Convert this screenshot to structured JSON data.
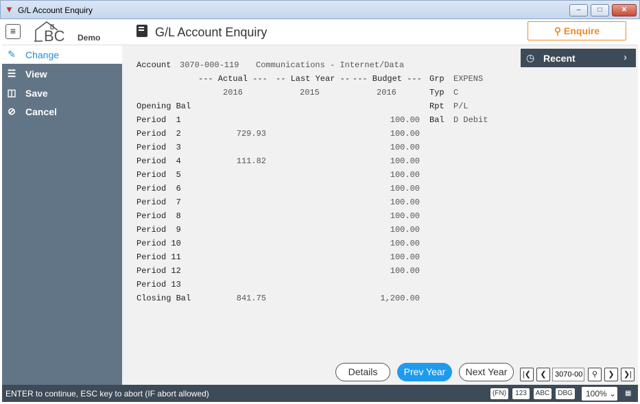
{
  "window": {
    "title": "G/L Account Enquiry"
  },
  "header": {
    "logo_text": "BC",
    "logo_sub": "Demo",
    "page_title": "G/L Account Enquiry",
    "enquire_label": "Enquire"
  },
  "sidebar": {
    "items": [
      {
        "label": "Change",
        "icon": "pencil-icon"
      },
      {
        "label": "View",
        "icon": "list-icon"
      },
      {
        "label": "Save",
        "icon": "save-icon"
      },
      {
        "label": "Cancel",
        "icon": "cancel-icon"
      }
    ]
  },
  "recent": {
    "label": "Recent"
  },
  "account": {
    "label": "Account",
    "code": "3070-000-119",
    "description": "Communications - Internet/Data"
  },
  "table": {
    "headers": [
      "--- Actual ---",
      "-- Last Year --",
      "--- Budget ---"
    ],
    "years": [
      "2016",
      "2015",
      "2016"
    ],
    "rows": [
      {
        "label": "Opening Bal",
        "actual": "",
        "last": "",
        "budget": ""
      },
      {
        "label": "Period  1",
        "actual": "",
        "last": "",
        "budget": "100.00"
      },
      {
        "label": "Period  2",
        "actual": "729.93",
        "last": "",
        "budget": "100.00"
      },
      {
        "label": "Period  3",
        "actual": "",
        "last": "",
        "budget": "100.00"
      },
      {
        "label": "Period  4",
        "actual": "111.82",
        "last": "",
        "budget": "100.00"
      },
      {
        "label": "Period  5",
        "actual": "",
        "last": "",
        "budget": "100.00"
      },
      {
        "label": "Period  6",
        "actual": "",
        "last": "",
        "budget": "100.00"
      },
      {
        "label": "Period  7",
        "actual": "",
        "last": "",
        "budget": "100.00"
      },
      {
        "label": "Period  8",
        "actual": "",
        "last": "",
        "budget": "100.00"
      },
      {
        "label": "Period  9",
        "actual": "",
        "last": "",
        "budget": "100.00"
      },
      {
        "label": "Period 10",
        "actual": "",
        "last": "",
        "budget": "100.00"
      },
      {
        "label": "Period 11",
        "actual": "",
        "last": "",
        "budget": "100.00"
      },
      {
        "label": "Period 12",
        "actual": "",
        "last": "",
        "budget": "100.00"
      },
      {
        "label": "Period 13",
        "actual": "",
        "last": "",
        "budget": ""
      },
      {
        "label": "Closing Bal",
        "actual": "841.75",
        "last": "",
        "budget": "1,200.00"
      }
    ]
  },
  "info": [
    {
      "key": "Grp",
      "value": "EXPENS"
    },
    {
      "key": "Typ",
      "value": "C"
    },
    {
      "key": "Rpt",
      "value": "P/L"
    },
    {
      "key": "Bal",
      "value": "D Debit"
    }
  ],
  "buttons": {
    "details": "Details",
    "prev_year": "Prev Year",
    "next_year": "Next Year"
  },
  "nav": {
    "current_value": "3070-00"
  },
  "status": {
    "message": "ENTER to continue, ESC key to abort (IF abort allowed)",
    "chips": [
      "(FN)",
      "123",
      "ABC",
      "DBG"
    ],
    "zoom": "100%"
  },
  "colors": {
    "sidebar_bg": "#627587",
    "accent_blue": "#1e9bef",
    "enquire_orange": "#f08a24",
    "status_bg": "#3d4a57"
  }
}
